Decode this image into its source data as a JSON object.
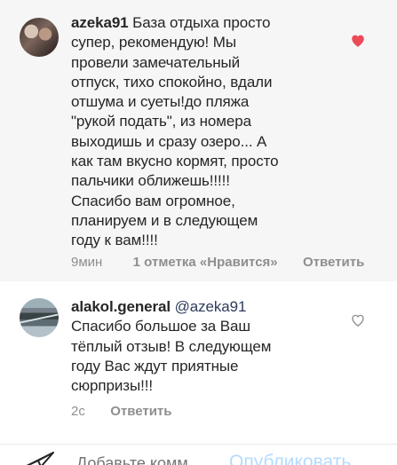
{
  "comments": [
    {
      "username": "azeka91",
      "text_lines": [
        "База отдыха просто",
        "супер, рекомендую! Мы",
        "провели замечательный",
        "отпуск, тихо спокойно, вдали",
        "отшума и суеты!до пляжа",
        "\"рукой подать\", из номера",
        "выходишь и сразу озеро... А",
        "как там вкусно кормят, просто",
        "пальчики оближешь!!!!!",
        "Спасибо вам огромное,",
        "планируем и в следующем",
        "году к вам!!!!"
      ],
      "time": "9мин",
      "likes": "1 отметка «Нравится»",
      "reply": "Ответить",
      "liked": true,
      "heart_color": "#ed4956"
    },
    {
      "username": "alakol.general",
      "mention": "@azeka91",
      "text_lines": [
        "Спасибо большое за Ваш",
        "тёплый отзыв! В следующем",
        "году Вас ждут приятные",
        "сюрпризы!!!"
      ],
      "time": "2с",
      "reply": "Ответить",
      "liked": false,
      "heart_color": "#8e8e8e"
    }
  ],
  "comment_bar": {
    "placeholder": "Добавьте комм...",
    "publish_label": "Опубликовать"
  }
}
